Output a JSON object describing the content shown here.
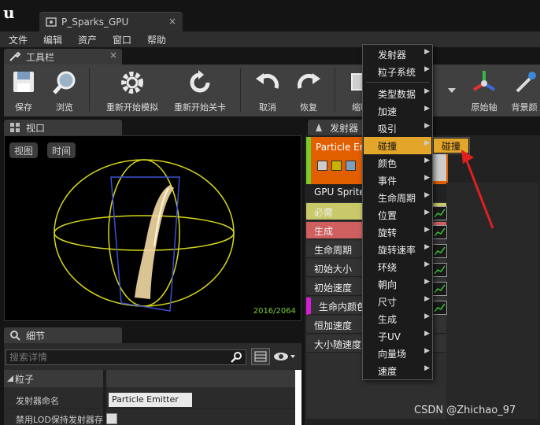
{
  "title_bar": {
    "doc_tab_label": "P_Sparks_GPU",
    "close_glyph": "×"
  },
  "menu": {
    "items": [
      "文件",
      "编辑",
      "资产",
      "窗口",
      "帮助"
    ]
  },
  "toolbar": {
    "tab_label": "工具栏",
    "buttons": [
      "保存",
      "浏览",
      "重新开始模拟",
      "重新开始关卡",
      "取消",
      "恢复",
      "缩略",
      "原始轴",
      "背景颜"
    ]
  },
  "viewport": {
    "tab_label": "视口",
    "view_button": "视图",
    "time_button": "时间",
    "particle_count": "2016/2064"
  },
  "details": {
    "tab_label": "细节",
    "search_placeholder": "搜索详情",
    "category": "粒子",
    "rows": [
      {
        "name": "发射器命名",
        "value": "Particle Emitter"
      },
      {
        "name": "禁用LOD保持发射器存",
        "value": ""
      }
    ]
  },
  "emitters": {
    "tab_label": "发射器",
    "emitter_name": "Particle Emitter",
    "modules": [
      "GPU Sprites",
      "必需",
      "生成",
      "生命周期",
      "初始大小",
      "初始速度",
      "生命内颜色",
      "恒加速度",
      "大小随速度"
    ]
  },
  "context_menu": {
    "items": [
      "发射器",
      "粒子系统",
      "类型数据",
      "加速",
      "吸引",
      "碰撞",
      "颜色",
      "事件",
      "生命周期",
      "位置",
      "旋转",
      "旋转速率",
      "环绕",
      "朝向",
      "尺寸",
      "生成",
      "子UV",
      "向量场",
      "速度"
    ],
    "active_index": 5,
    "submenu_item": "碰撞"
  },
  "colors": {
    "accent": "#e3a62a",
    "emitter_header": "#e25f00",
    "required": "#c9c96a",
    "spawn": "#d06060",
    "annotation_arrow": "#e0201e"
  },
  "watermark": "CSDN @Zhichao_97"
}
